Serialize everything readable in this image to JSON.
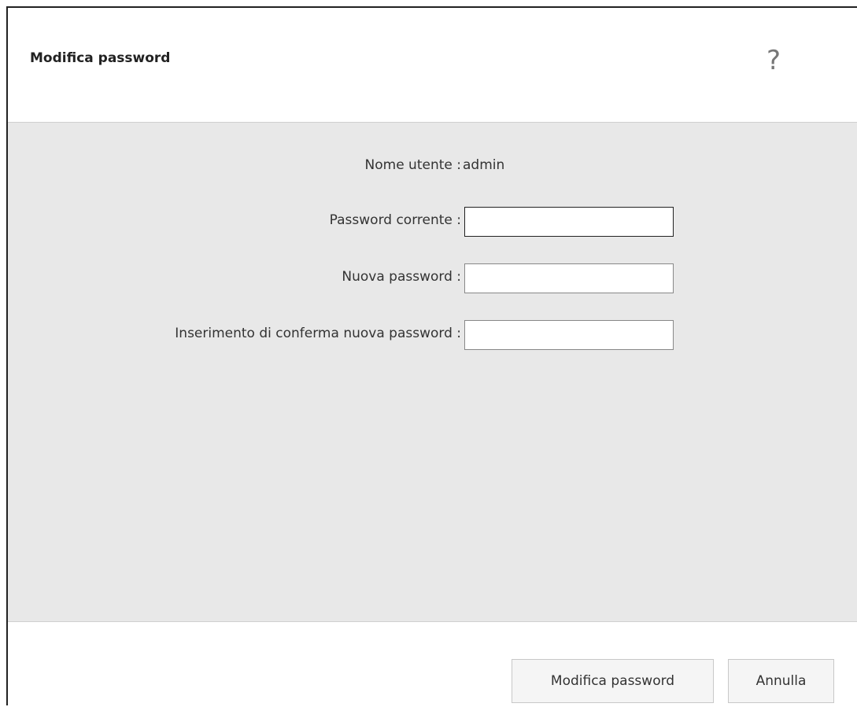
{
  "dialog": {
    "title": "Modifica password",
    "help_icon": "question-mark-icon",
    "help_glyph": "?"
  },
  "form": {
    "username_label": "Nome utente :",
    "username_value": "admin",
    "current_password_label": "Password corrente :",
    "current_password_value": "",
    "new_password_label": "Nuova password :",
    "new_password_value": "",
    "confirm_password_label": "Inserimento di conferma nuova password :",
    "confirm_password_value": ""
  },
  "footer": {
    "change_button_label": "Modifica password",
    "cancel_button_label": "Annulla"
  }
}
